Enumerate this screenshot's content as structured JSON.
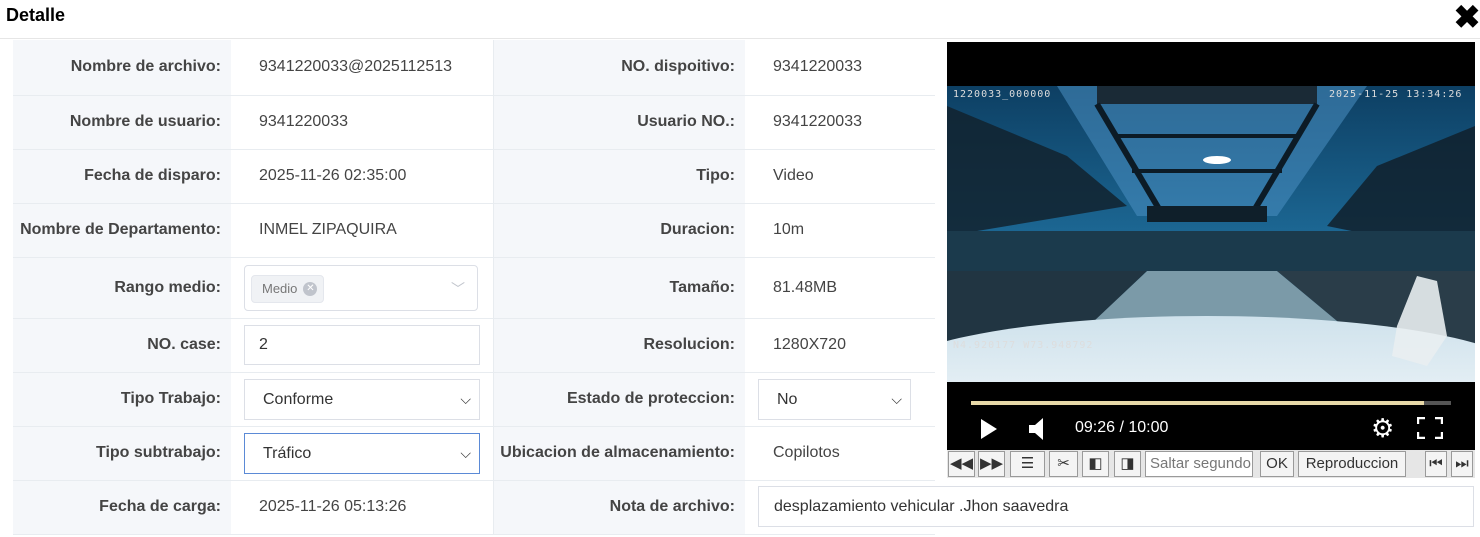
{
  "dialog": {
    "title": "Detalle",
    "close_icon": "close-icon"
  },
  "fields": {
    "nombre_archivo": {
      "label": "Nombre de archivo:",
      "value": "9341220033@2025112513"
    },
    "no_dispositivo": {
      "label": "NO. dispoitivo:",
      "value": "9341220033"
    },
    "nombre_usuario": {
      "label": "Nombre de usuario:",
      "value": "9341220033"
    },
    "usuario_no": {
      "label": "Usuario NO.:",
      "value": "9341220033"
    },
    "fecha_disparo": {
      "label": "Fecha de disparo:",
      "value": "2025-11-26 02:35:00"
    },
    "tipo": {
      "label": "Tipo:",
      "value": "Video"
    },
    "departamento": {
      "label": "Nombre de Departamento:",
      "value": "INMEL ZIPAQUIRA"
    },
    "duracion": {
      "label": "Duracion:",
      "value": "10m"
    },
    "rango_medio": {
      "label": "Rango medio:",
      "tag": "Medio"
    },
    "tamano": {
      "label": "Tamaño:",
      "value": "81.48MB"
    },
    "no_case": {
      "label": "NO. case:",
      "value": "2"
    },
    "resolucion": {
      "label": "Resolucion:",
      "value": "1280X720"
    },
    "tipo_trabajo": {
      "label": "Tipo Trabajo:",
      "value": "Conforme"
    },
    "estado_proteccion": {
      "label": "Estado de proteccion:",
      "value": "No"
    },
    "tipo_subtrabajo": {
      "label": "Tipo subtrabajo:",
      "value": "Tráfico"
    },
    "ubicacion": {
      "label": "Ubicacion de almacenamiento:",
      "value": "Copilotos"
    },
    "fecha_carga": {
      "label": "Fecha de carga:",
      "value": "2025-11-26 05:13:26"
    },
    "nota": {
      "label": "Nota de archivo:",
      "value": "desplazamiento vehicular .Jhon saavedra"
    }
  },
  "player": {
    "osd_top_left": "1220033_000000",
    "osd_top_right": "2025-11-25 13:34:26",
    "osd_bottom_left": "N4.920177 W73.948792",
    "time": "09:26 / 10:00",
    "progress_fraction": 0.943,
    "icons": [
      "play-icon",
      "volume-icon",
      "gear-icon",
      "fullscreen-icon"
    ]
  },
  "toolbar": {
    "rewind": "◀◀",
    "forward": "▶▶",
    "seek_placeholder": "Saltar segundo",
    "ok_label": "OK",
    "playback_label": "Reproduccion",
    "icons": [
      "rewind-icon",
      "fast-forward-icon",
      "list-icon",
      "scissors-icon",
      "prev-frame-icon",
      "next-frame-icon",
      "skip-start-icon",
      "skip-end-icon"
    ]
  }
}
